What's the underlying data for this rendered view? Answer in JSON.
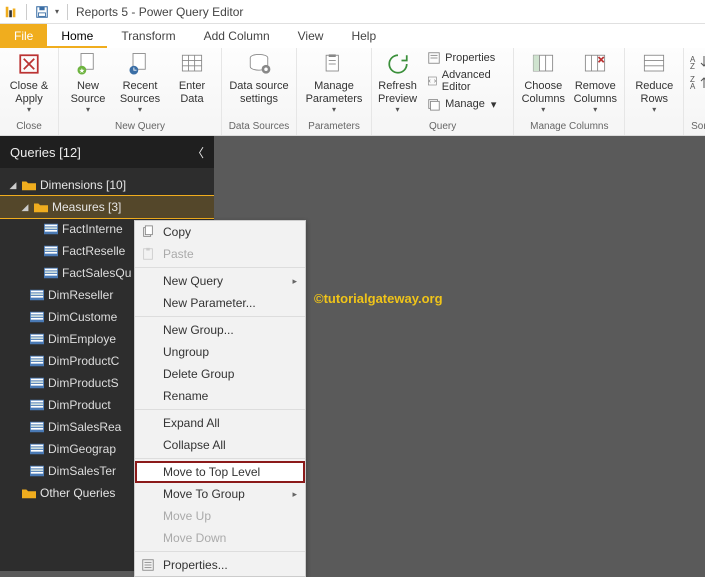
{
  "titlebar": {
    "title": "Reports 5 - Power Query Editor"
  },
  "menubar": {
    "file": "File",
    "tabs": [
      "Home",
      "Transform",
      "Add Column",
      "View",
      "Help"
    ]
  },
  "ribbon": {
    "close": {
      "close_apply": "Close &\nApply",
      "group": "Close"
    },
    "newquery": {
      "new_source": "New\nSource",
      "recent_sources": "Recent\nSources",
      "enter_data": "Enter\nData",
      "group": "New Query"
    },
    "datasources": {
      "ds_settings": "Data source\nsettings",
      "group": "Data Sources"
    },
    "parameters": {
      "manage_params": "Manage\nParameters",
      "group": "Parameters"
    },
    "query": {
      "refresh": "Refresh\nPreview",
      "properties": "Properties",
      "advanced": "Advanced Editor",
      "manage": "Manage",
      "group": "Query"
    },
    "managecols": {
      "choose": "Choose\nColumns",
      "remove": "Remove\nColumns",
      "group": "Manage Columns"
    },
    "reduce": {
      "reduce_rows": "Reduce\nRows",
      "group": ""
    },
    "sort": {
      "group": "Sort"
    }
  },
  "queries": {
    "header": "Queries [12]",
    "folders": {
      "dimensions": "Dimensions [10]",
      "measures": "Measures [3]",
      "other": "Other Queries"
    },
    "measure_items": [
      "FactInterne",
      "FactReselle",
      "FactSalesQu"
    ],
    "dim_items": [
      "DimReseller",
      "DimCustome",
      "DimEmploye",
      "DimProductC",
      "DimProductS",
      "DimProduct",
      "DimSalesRea",
      "DimGeograp",
      "DimSalesTer"
    ]
  },
  "watermark": "©tutorialgateway.org",
  "context_menu": {
    "copy": "Copy",
    "paste": "Paste",
    "new_query": "New Query",
    "new_parameter": "New Parameter...",
    "new_group": "New Group...",
    "ungroup": "Ungroup",
    "delete_group": "Delete Group",
    "rename": "Rename",
    "expand_all": "Expand All",
    "collapse_all": "Collapse All",
    "move_top": "Move to Top Level",
    "move_group": "Move To Group",
    "move_up": "Move Up",
    "move_down": "Move Down",
    "properties": "Properties..."
  }
}
